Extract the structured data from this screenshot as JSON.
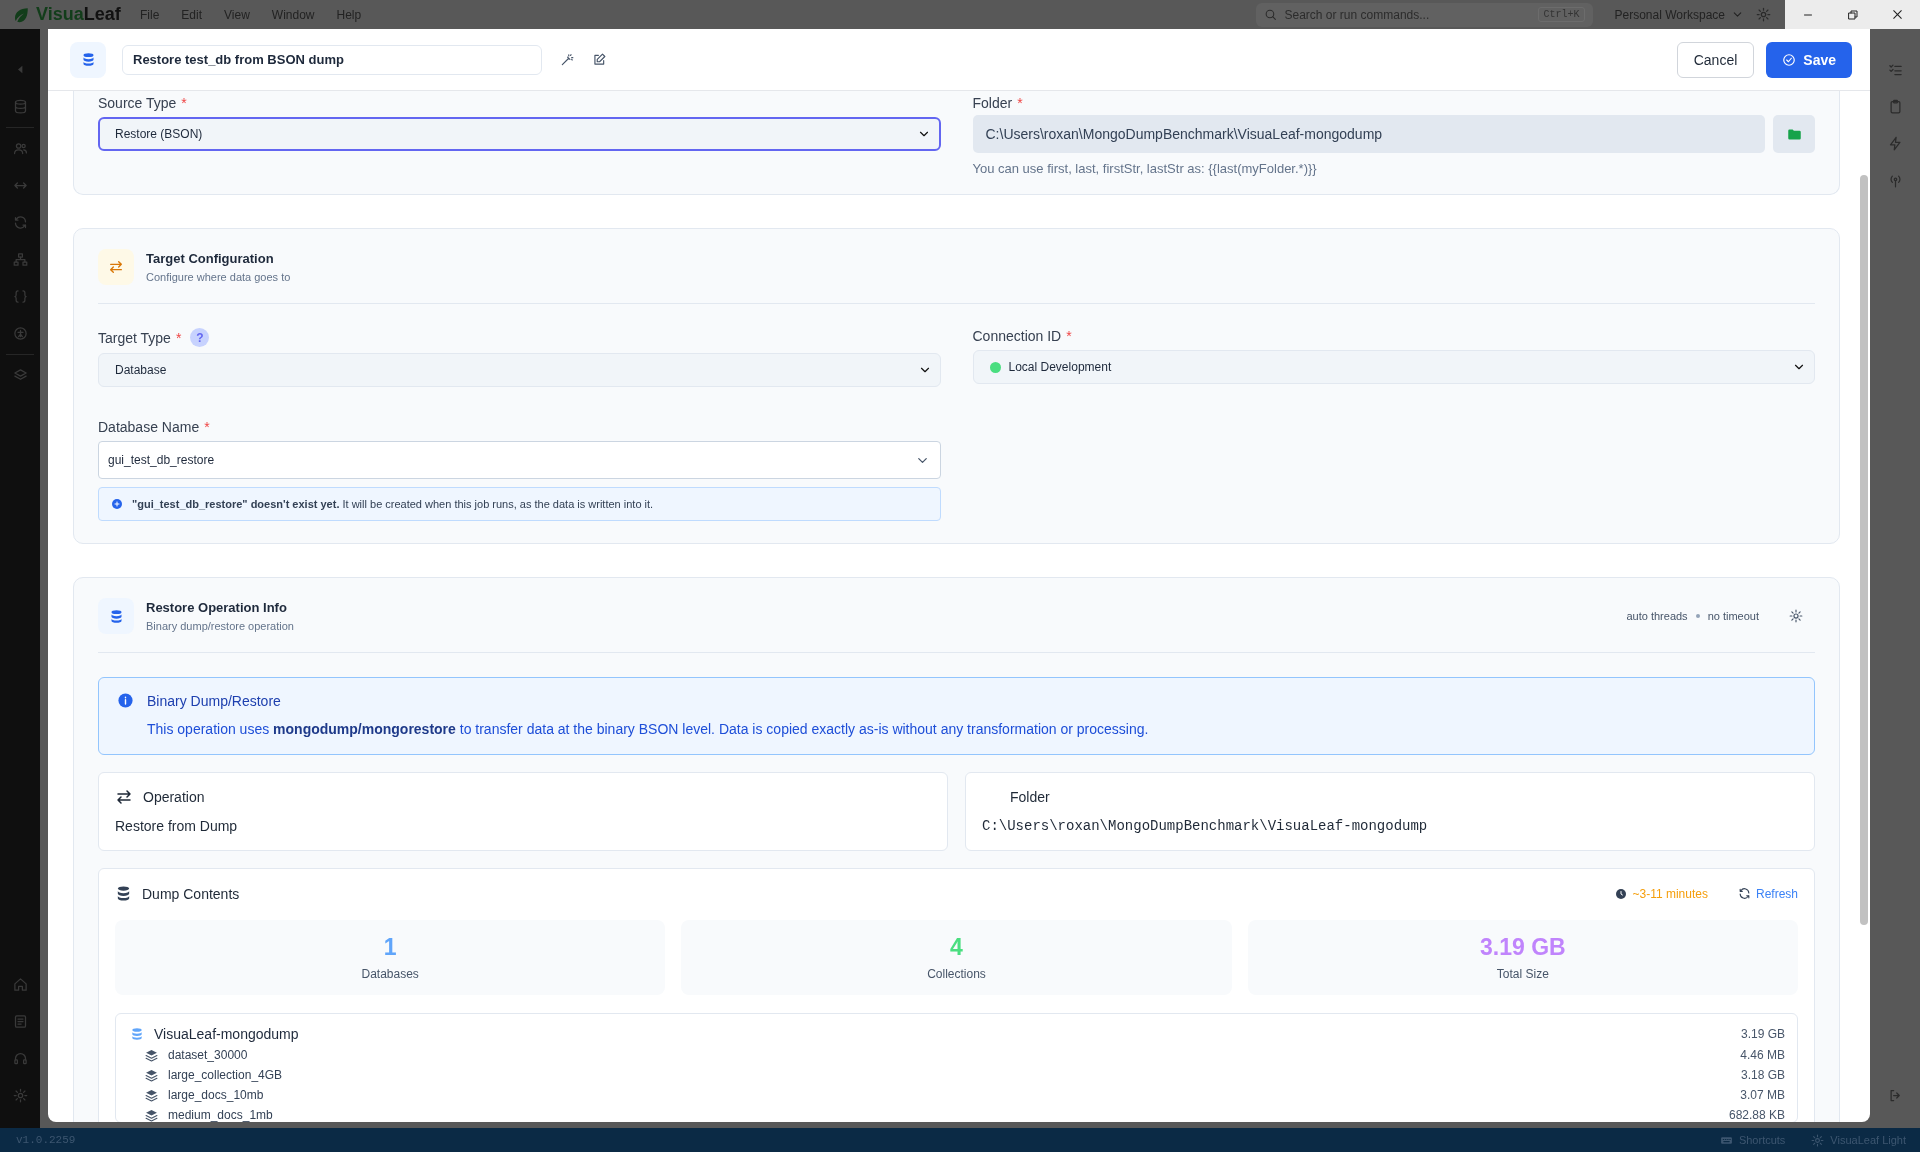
{
  "app_bar": {
    "logo_first": "Visua",
    "logo_second": "Leaf",
    "menu": [
      "File",
      "Edit",
      "View",
      "Window",
      "Help"
    ],
    "search": {
      "placeholder": "Search or run commands...",
      "shortcut": "Ctrl+K"
    },
    "workspace": "Personal Workspace"
  },
  "modal": {
    "title": "Restore test_db from BSON dump",
    "cancel": "Cancel",
    "save": "Save"
  },
  "source": {
    "fields": [
      {
        "label": "Source Type",
        "required_mark": "*",
        "value": "Restore (BSON)",
        "kind": "select",
        "focused": true
      },
      {
        "label": "Folder",
        "required_mark": "*",
        "value": "C:\\Users\\roxan\\MongoDumpBenchmark\\VisuaLeaf-mongodump",
        "kind": "folder",
        "hint": "You can use first, last, firstStr, lastStr as: {{last(myFolder.*)}}"
      }
    ]
  },
  "target": {
    "title": "Target Configuration",
    "subtitle": "Configure where data goes to",
    "fields": [
      {
        "label": "Target Type",
        "required_mark": "*",
        "help": "?",
        "value": "Database",
        "kind": "select"
      },
      {
        "label": "Connection ID",
        "required_mark": "*",
        "value": "Local Development",
        "kind": "select",
        "color": "#4ade80"
      },
      {
        "label": "Database Name",
        "required_mark": "*",
        "value": "gui_test_db_restore",
        "kind": "combo",
        "notice": "**\"gui_test_db_restore\" doesn't exist yet.** It will be created when this job runs, as the data is written into it."
      }
    ]
  },
  "operation": {
    "title": "Restore Operation Info",
    "subtitle": "Binary dump/restore operation",
    "tags": [
      "auto threads",
      "no timeout"
    ],
    "info": {
      "title": "Binary Dump/Restore",
      "text": "This operation uses **mongodump/mongorestore** to transfer data at the binary BSON level. Data is copied exactly as-is without any transformation or processing."
    },
    "details": [
      {
        "label": "Operation",
        "value": "Restore from Dump",
        "kind": "text"
      },
      {
        "label": "Folder",
        "value": "C:\\Users\\roxan\\MongoDumpBenchmark\\VisuaLeaf-mongodump",
        "kind": "path"
      }
    ],
    "dump": {
      "title": "Dump Contents",
      "estimate": "~3-11 minutes",
      "refresh": "Refresh",
      "stats": [
        {
          "value": "1",
          "label": "Databases",
          "color": "#60a5fa"
        },
        {
          "value": "4",
          "label": "Collections",
          "color": "#4ade80"
        },
        {
          "value": "3.19 GB",
          "label": "Total Size",
          "color": "#c084fc"
        }
      ],
      "tree": [
        {
          "name": "VisuaLeaf-mongodump",
          "size": "3.19 GB",
          "children": [
            {
              "name": "dataset_30000",
              "size": "4.46 MB"
            },
            {
              "name": "large_collection_4GB",
              "size": "3.18 GB"
            },
            {
              "name": "large_docs_10mb",
              "size": "3.07 MB"
            },
            {
              "name": "medium_docs_1mb",
              "size": "682.88 KB"
            }
          ]
        }
      ]
    }
  },
  "status_bar": {
    "version": "v1.0.2259",
    "items": [
      {
        "label": "Shortcuts",
        "kind": "keyboard"
      },
      {
        "label": "VisuaLeaf Light",
        "kind": "theme"
      }
    ]
  }
}
